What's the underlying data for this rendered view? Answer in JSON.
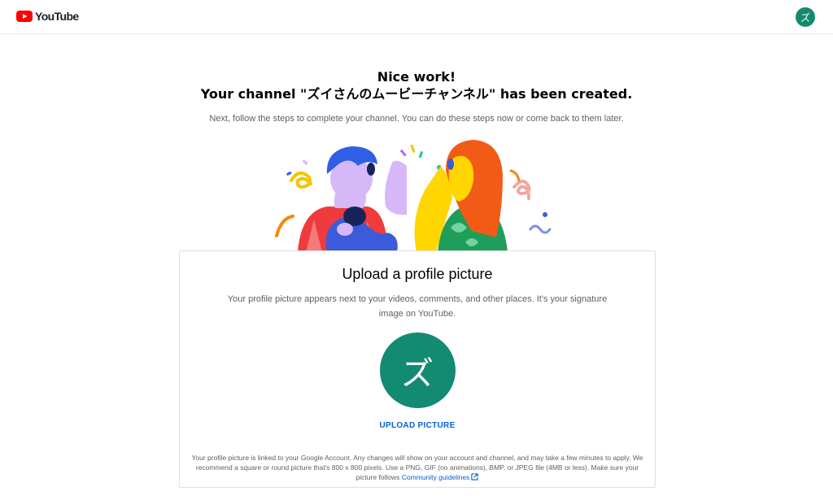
{
  "header": {
    "logo_text": "YouTube",
    "avatar_letter": "ズ"
  },
  "hero": {
    "title": "Nice work!",
    "created_prefix": "Your channel \"",
    "channel_name": "ズイさんのムービーチャンネル",
    "created_suffix": "\" has been created.",
    "subtitle": "Next, follow the steps to complete your channel. You can do these steps now or come back to them later."
  },
  "upload_card": {
    "title": "Upload a profile picture",
    "description": "Your profile picture appears next to your videos, comments, and other places. It's your signature image on YouTube.",
    "avatar_letter": "ズ",
    "upload_button_label": "UPLOAD PICTURE",
    "fine_print": "Your profile picture is linked to your Google Account. Any changes will show on your account and channel, and may take a few minutes to apply. We recommend a square or round picture that's 800 x 800 pixels. Use a PNG, GIF (no animations), BMP, or JPEG file (4MB or less). Make sure your picture follows",
    "guidelines_link": "Community guidelines"
  },
  "colors": {
    "brand_red": "#ff0000",
    "avatar_green": "#138a72",
    "link_blue": "#065fd4"
  },
  "icons": {
    "logo": "youtube-play-icon",
    "external_link": "external-link-icon"
  }
}
